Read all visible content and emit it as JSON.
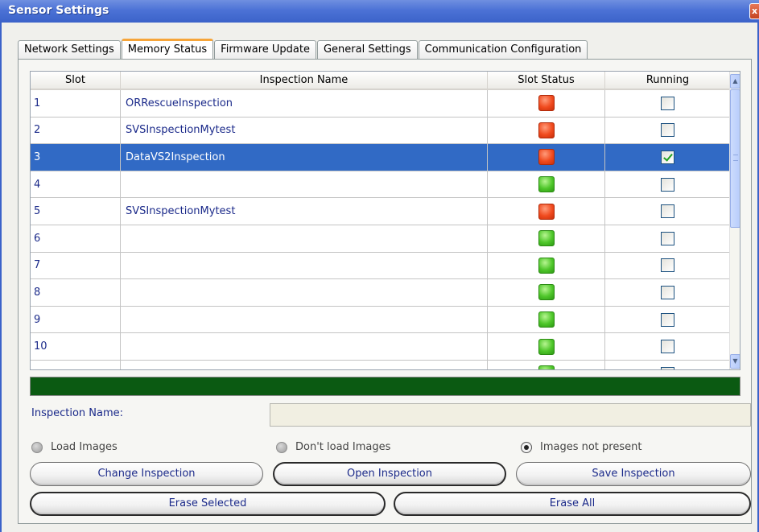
{
  "window": {
    "title": "Sensor Settings",
    "close_label": "x"
  },
  "tabs": [
    {
      "label": "Network Settings",
      "active": false
    },
    {
      "label": "Memory Status",
      "active": true
    },
    {
      "label": "Firmware Update",
      "active": false
    },
    {
      "label": "General Settings",
      "active": false
    },
    {
      "label": "Communication Configuration",
      "active": false
    }
  ],
  "table": {
    "headers": {
      "slot": "Slot",
      "name": "Inspection Name",
      "status": "Slot Status",
      "running": "Running"
    },
    "rows": [
      {
        "slot": "1",
        "name": "ORRescueInspection",
        "status": "red",
        "running": false,
        "selected": false
      },
      {
        "slot": "2",
        "name": "SVSInspectionMytest",
        "status": "red",
        "running": false,
        "selected": false
      },
      {
        "slot": "3",
        "name": "DataVS2Inspection",
        "status": "red",
        "running": true,
        "selected": true
      },
      {
        "slot": "4",
        "name": "",
        "status": "green",
        "running": false,
        "selected": false
      },
      {
        "slot": "5",
        "name": "SVSInspectionMytest",
        "status": "red",
        "running": false,
        "selected": false
      },
      {
        "slot": "6",
        "name": "",
        "status": "green",
        "running": false,
        "selected": false
      },
      {
        "slot": "7",
        "name": "",
        "status": "green",
        "running": false,
        "selected": false
      },
      {
        "slot": "8",
        "name": "",
        "status": "green",
        "running": false,
        "selected": false
      },
      {
        "slot": "9",
        "name": "",
        "status": "green",
        "running": false,
        "selected": false
      },
      {
        "slot": "10",
        "name": "",
        "status": "green",
        "running": false,
        "selected": false
      },
      {
        "slot": "",
        "name": "",
        "status": "green",
        "running": false,
        "selected": false
      }
    ],
    "scroll_fraction": 0.5
  },
  "colors": {
    "status_red": "#f04a1e",
    "status_green": "#4ec62a",
    "selected_row": "#316ac5",
    "progress": "#0b5a12",
    "tab_accent": "#f6a53a"
  },
  "progress": {
    "fraction": 1.0
  },
  "inspection_name": {
    "label": "Inspection Name:",
    "value": ""
  },
  "radios": [
    {
      "label": "Load Images",
      "selected": false
    },
    {
      "label": "Don't load Images",
      "selected": false
    },
    {
      "label": "Images not present",
      "selected": true
    }
  ],
  "buttons": {
    "change": "Change Inspection",
    "open": "Open Inspection",
    "save": "Save Inspection",
    "erase_selected": "Erase Selected",
    "erase_all": "Erase All"
  }
}
